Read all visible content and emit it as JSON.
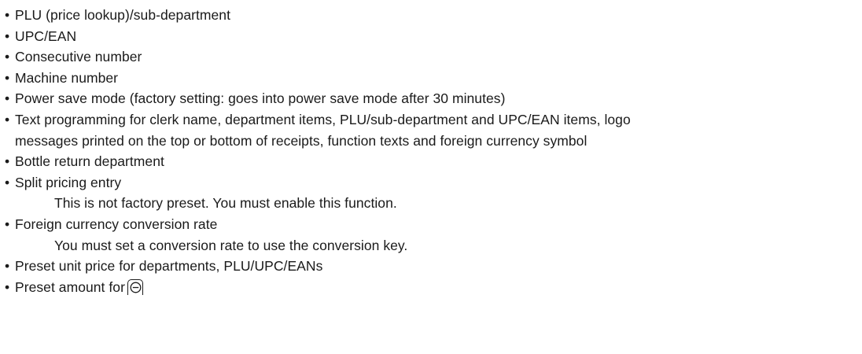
{
  "items": [
    "PLU (price lookup)/sub-department",
    "UPC/EAN",
    "Consecutive number",
    "Machine number",
    "Power save mode (factory setting: goes into power save mode after 30 minutes)",
    "Text programming for clerk name, department items, PLU/sub-department and UPC/EAN items, logo",
    "messages printed on the top or bottom of receipts, function texts and foreign currency symbol",
    "Bottle return department",
    "Split pricing entry",
    "This is not factory preset.  You must enable this function.",
    "Foreign currency conversion rate",
    "You must set a conversion rate to use the conversion key.",
    "Preset unit price for departments, PLU/UPC/EANs",
    "Preset amount for"
  ],
  "bullet_glyph": "•",
  "minus_key": {
    "icon": "minus-key-icon"
  }
}
